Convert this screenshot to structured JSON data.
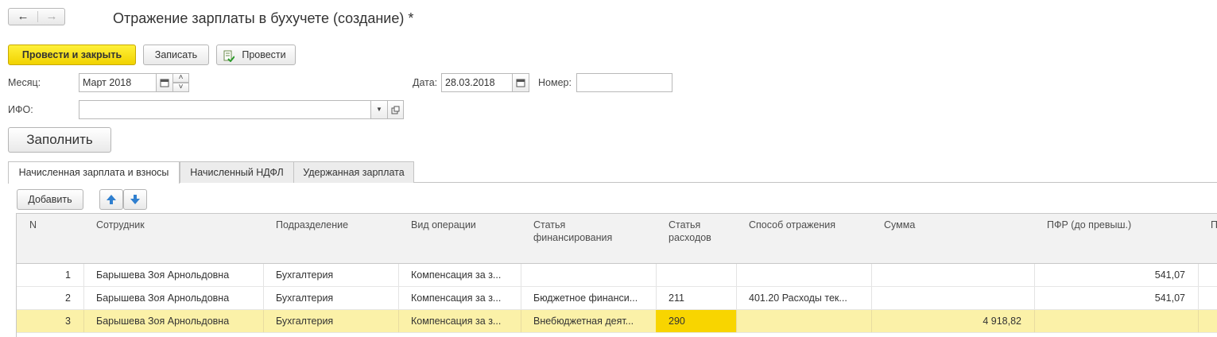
{
  "nav": {
    "back_icon": "←",
    "forward_icon": "→"
  },
  "title": "Отражение зарплаты в бухучете (создание) *",
  "toolbar": {
    "post_close_label": "Провести и закрыть",
    "save_label": "Записать",
    "post_label": "Провести"
  },
  "form": {
    "month_label": "Месяц:",
    "month_value": "Март 2018",
    "date_label": "Дата:",
    "date_value": "28.03.2018",
    "number_label": "Номер:",
    "number_value": "",
    "ifo_label": "ИФО:",
    "ifo_value": ""
  },
  "fill_button": "Заполнить",
  "tabs": [
    {
      "label": "Начисленная зарплата и взносы",
      "active": true
    },
    {
      "label": "Начисленный НДФЛ",
      "active": false
    },
    {
      "label": "Удержанная зарплата",
      "active": false
    }
  ],
  "table_toolbar": {
    "add_label": "Добавить"
  },
  "table": {
    "headers": {
      "n": "N",
      "employee": "Сотрудник",
      "department": "Подразделение",
      "operation": "Вид операции",
      "financing": "Статья финансирования",
      "expense": "Статья расходов",
      "method": "Способ отражения",
      "amount": "Сумма",
      "pfr": "ПФР (до превыш.)",
      "extra": "П"
    },
    "rows": [
      {
        "n": "1",
        "employee": "Барышева Зоя Арнольдовна",
        "department": "Бухгалтерия",
        "operation": "Компенсация за з...",
        "financing": "",
        "expense": "",
        "method": "",
        "amount": "",
        "pfr": "541,07"
      },
      {
        "n": "2",
        "employee": "Барышева Зоя Арнольдовна",
        "department": "Бухгалтерия",
        "operation": "Компенсация за з...",
        "financing": "Бюджетное финанси...",
        "expense": "211",
        "method": "401.20 Расходы тек...",
        "amount": "",
        "pfr": "541,07"
      },
      {
        "n": "3",
        "employee": "Барышева Зоя Арнольдовна",
        "department": "Бухгалтерия",
        "operation": "Компенсация за з...",
        "financing": "Внебюджетная деят...",
        "expense": "290",
        "method": "",
        "amount": "4 918,82",
        "pfr": ""
      }
    ]
  }
}
